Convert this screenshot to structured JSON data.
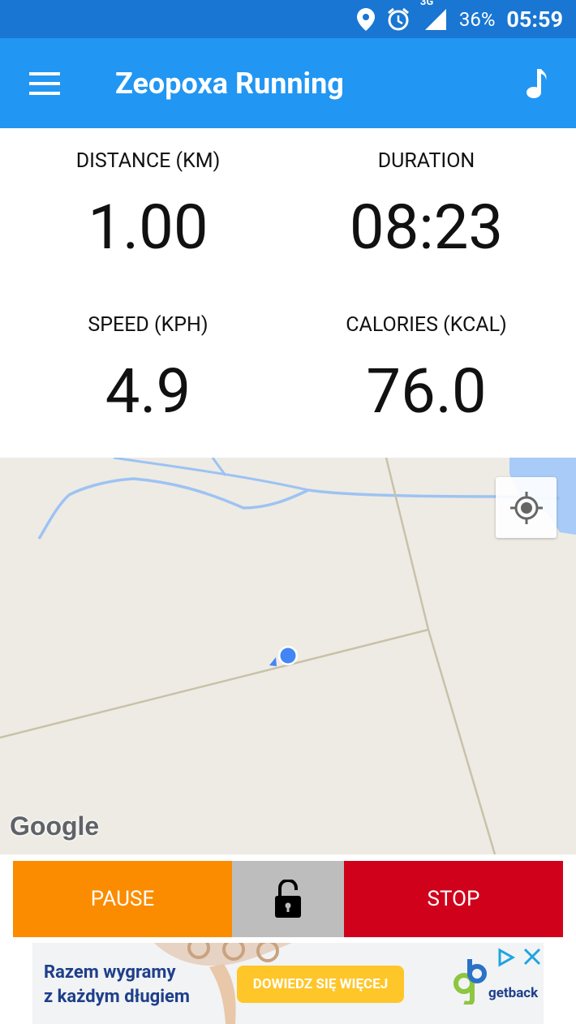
{
  "status_bar": {
    "network": "3G",
    "battery": "36%",
    "time": "05:59"
  },
  "app_bar": {
    "title": "Zeopoxa Running"
  },
  "stats": {
    "distance_label": "DISTANCE (KM)",
    "distance_value": "1.00",
    "duration_label": "DURATION",
    "duration_value": "08:23",
    "speed_label": "SPEED (KPH)",
    "speed_value": "4.9",
    "calories_label": "CALORIES (KCAL)",
    "calories_value": "76.0"
  },
  "map": {
    "logo_text": "Google"
  },
  "controls": {
    "pause_label": "PAUSE",
    "stop_label": "STOP"
  },
  "ad": {
    "line1": "Razem wygramy",
    "line2": "z każdym długiem",
    "cta": "DOWIEDZ SIĘ WIĘCEJ",
    "brand": "getback"
  },
  "colors": {
    "primary": "#2196F3",
    "primary_dark": "#1976D2",
    "pause": "#FB8C00",
    "lock": "#BDBDBD",
    "stop": "#D0021B",
    "location_dot": "#4285F4"
  }
}
